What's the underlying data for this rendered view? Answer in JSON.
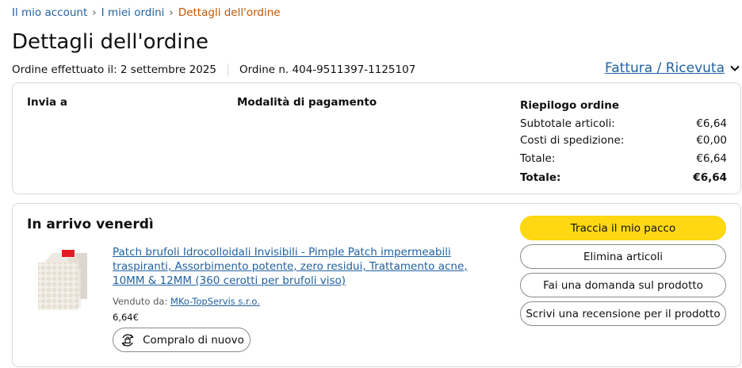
{
  "breadcrumb": {
    "items": [
      "Il mio account",
      "I miei ordini"
    ],
    "separator": "›",
    "current": "Dettagli dell'ordine"
  },
  "page": {
    "title": "Dettagli dell'ordine",
    "order_date": "Ordine effettuato il: 2 settembre 2025",
    "order_number": "Ordine n. 404-9511397-1125107",
    "invoice_link": "Fattura / Ricevuta"
  },
  "summary_box": {
    "ship_to_label": "Invia a",
    "payment_label": "Modalità di pagamento",
    "summary_title": "Riepilogo ordine",
    "rows": [
      {
        "label": "Subtotale articoli:",
        "value": "€6,64"
      },
      {
        "label": "Costi di spedizione:",
        "value": "€0,00"
      },
      {
        "label": "Totale:",
        "value": "€6,64"
      }
    ],
    "grand_total": {
      "label": "Totale:",
      "value": "€6,64"
    }
  },
  "shipment": {
    "status": "In arrivo venerdì",
    "product": {
      "title": "Patch brufoli Idrocolloidali Invisibili - Pimple Patch impermeabili traspiranti, Assorbimento potente, zero residui, Trattamento acne, 10MM & 12MM (360 cerotti per brufoli viso)",
      "sold_by_label": "Venduto da:",
      "seller": "MKo-TopServis s.r.o.",
      "price": "6,64€",
      "buy_again": "Compralo di nuovo"
    },
    "actions": {
      "track": "Traccia il mio pacco",
      "remove": "Elimina articoli",
      "question": "Fai una domanda sul prodotto",
      "review": "Scrivi una recensione per il prodotto"
    }
  },
  "colors": {
    "link": "#2162a1",
    "breadcrumb_current": "#c45500",
    "primary_button": "#ffd814",
    "border": "#d5d9d9"
  },
  "icons": {
    "invoice_chevron": "chevron-down-icon",
    "buy_again": "reorder-icon"
  }
}
